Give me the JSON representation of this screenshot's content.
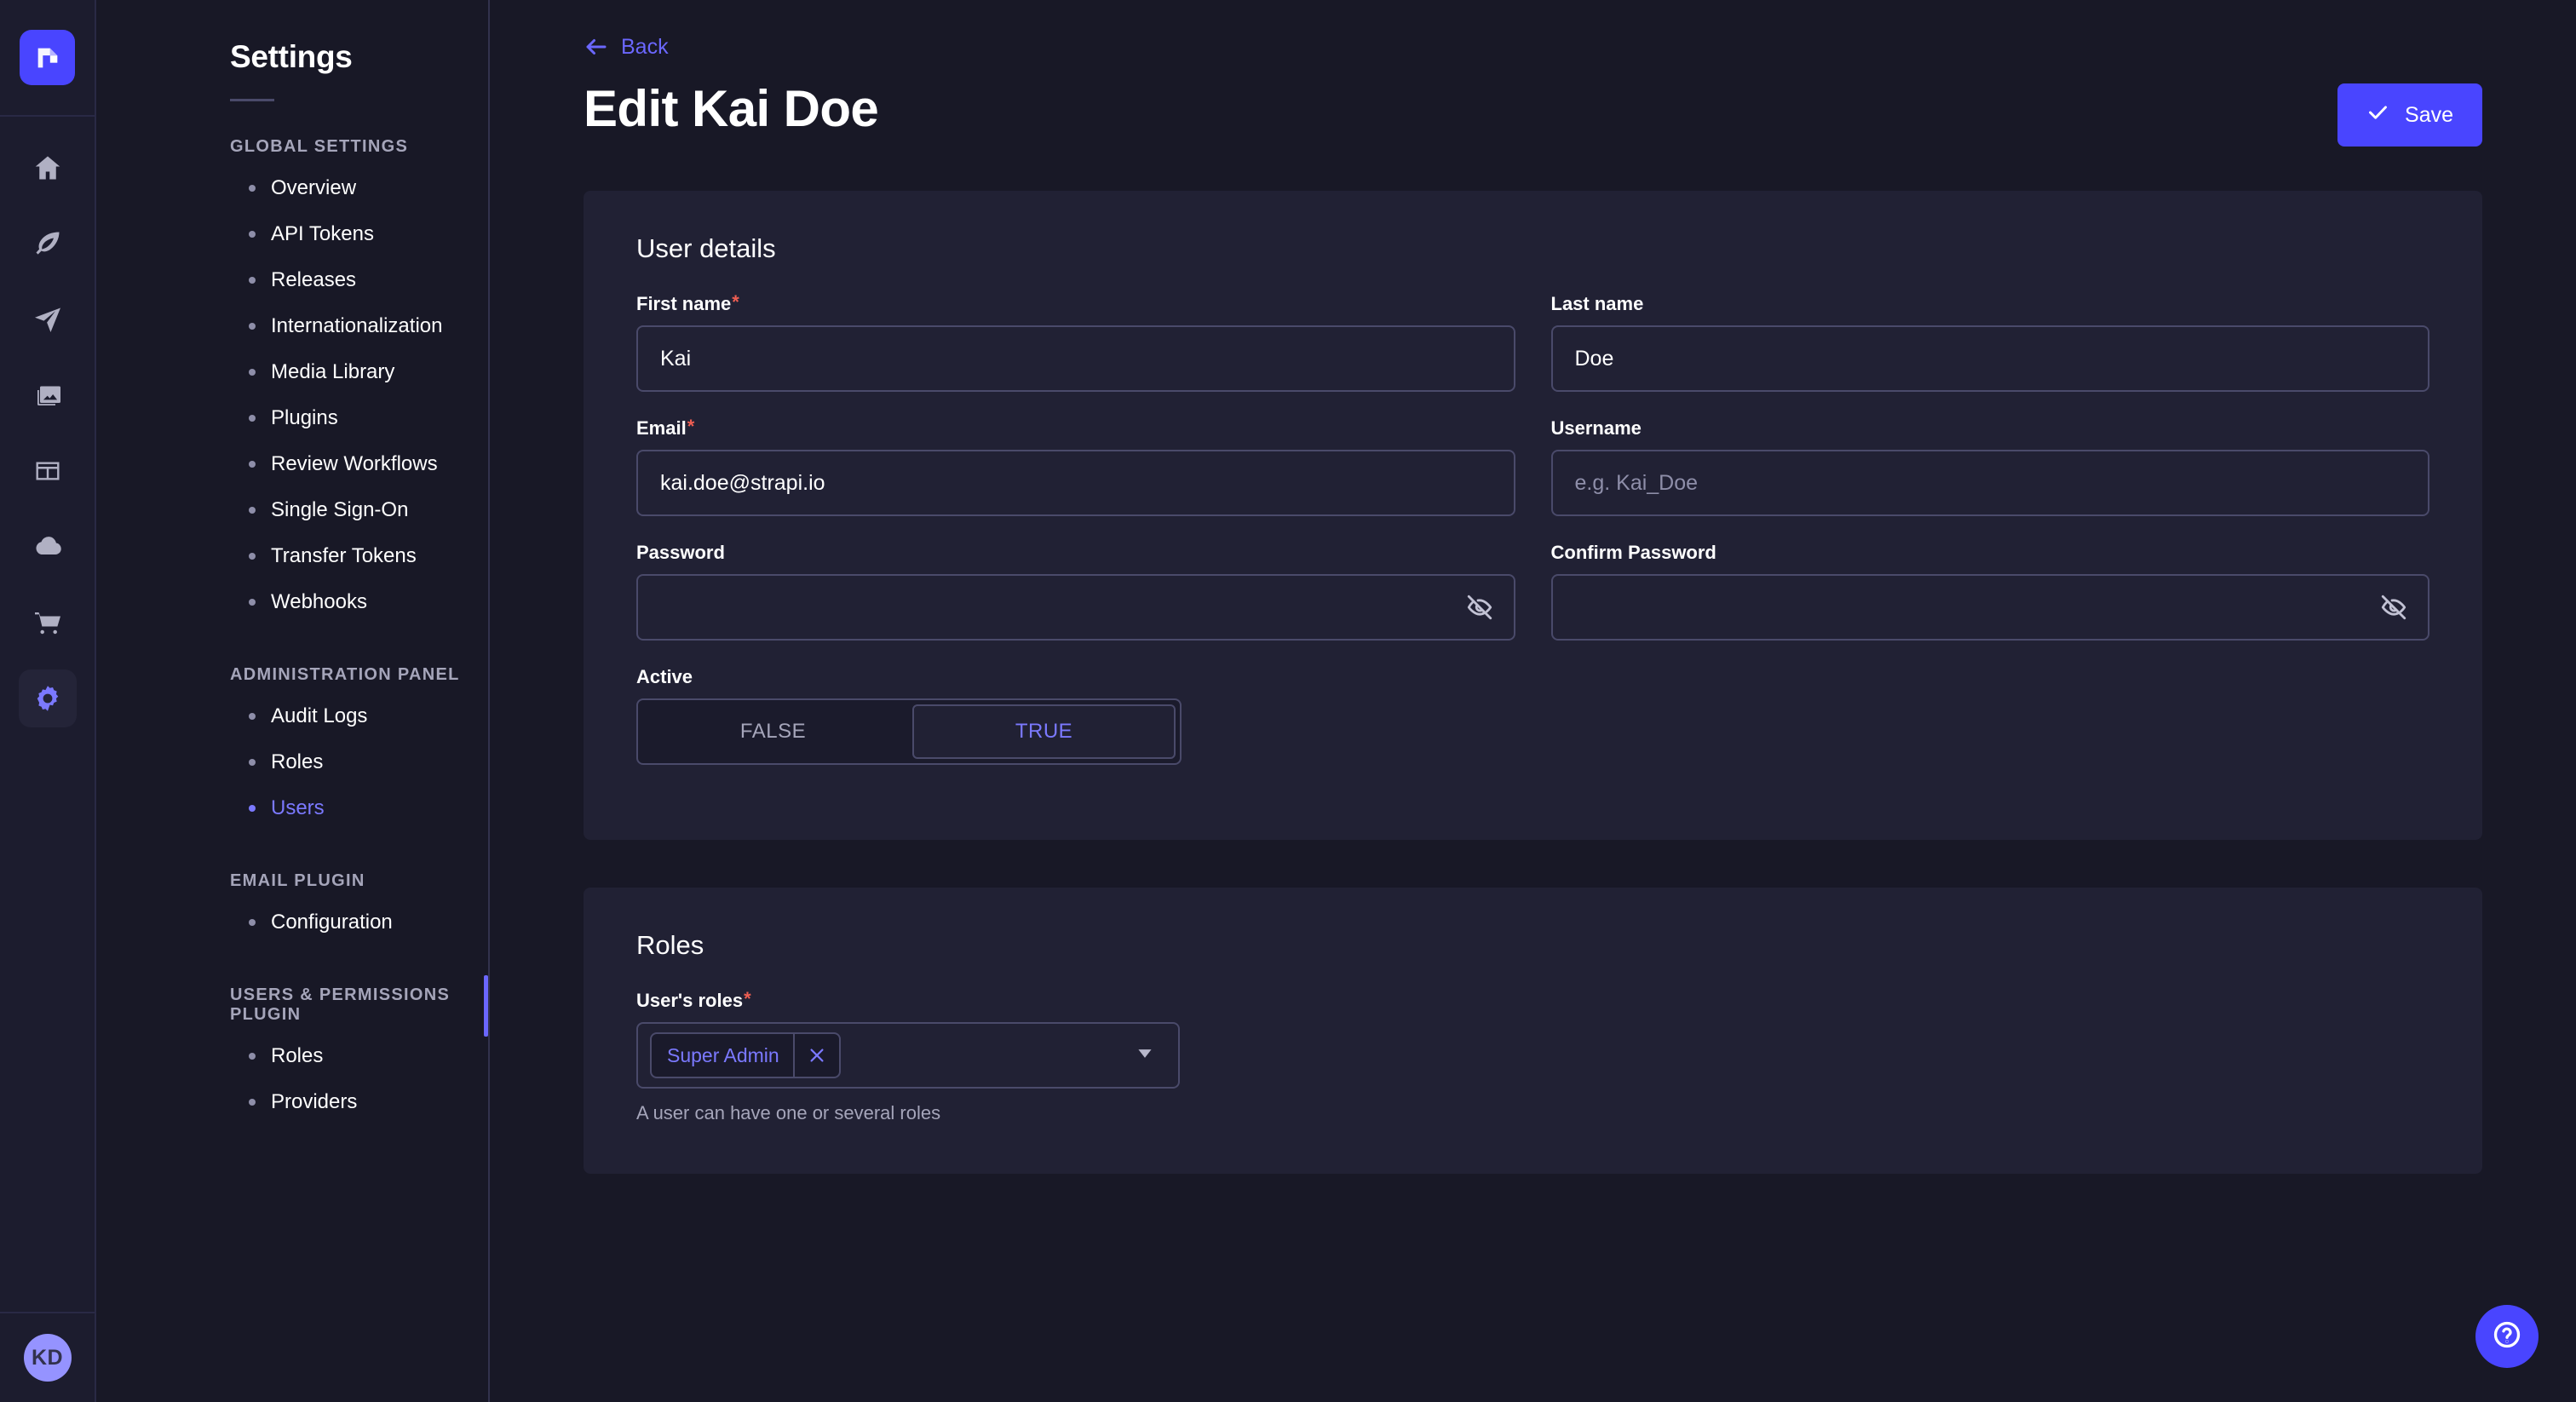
{
  "brand": {
    "accent": "#4945ff",
    "accent_light": "#7b79ff",
    "required_color": "#ee5e52",
    "panel_bg": "#212134",
    "page_bg": "#181826"
  },
  "rail": {
    "logo_icon": "strapi-logo-icon",
    "items": [
      {
        "icon": "home-icon",
        "name": "home",
        "active": false
      },
      {
        "icon": "feather-icon",
        "name": "content-manager",
        "active": false
      },
      {
        "icon": "paper-plane-icon",
        "name": "content-type-builder",
        "active": false
      },
      {
        "icon": "images-icon",
        "name": "media-library",
        "active": false
      },
      {
        "icon": "layout-icon",
        "name": "pages",
        "active": false
      },
      {
        "icon": "cloud-icon",
        "name": "cloud",
        "active": false
      },
      {
        "icon": "shopping-cart-icon",
        "name": "marketplace",
        "active": false
      },
      {
        "icon": "gear-icon",
        "name": "settings",
        "active": true
      }
    ],
    "avatar_initials": "KD"
  },
  "sidebar": {
    "title": "Settings",
    "sections": [
      {
        "label": "GLOBAL SETTINGS",
        "items": [
          {
            "label": "Overview",
            "active": false
          },
          {
            "label": "API Tokens",
            "active": false
          },
          {
            "label": "Releases",
            "active": false
          },
          {
            "label": "Internationalization",
            "active": false
          },
          {
            "label": "Media Library",
            "active": false
          },
          {
            "label": "Plugins",
            "active": false
          },
          {
            "label": "Review Workflows",
            "active": false
          },
          {
            "label": "Single Sign-On",
            "active": false
          },
          {
            "label": "Transfer Tokens",
            "active": false
          },
          {
            "label": "Webhooks",
            "active": false
          }
        ]
      },
      {
        "label": "ADMINISTRATION PANEL",
        "items": [
          {
            "label": "Audit Logs",
            "active": false
          },
          {
            "label": "Roles",
            "active": false
          },
          {
            "label": "Users",
            "active": true
          }
        ]
      },
      {
        "label": "EMAIL PLUGIN",
        "items": [
          {
            "label": "Configuration",
            "active": false
          }
        ]
      },
      {
        "label": "USERS & PERMISSIONS PLUGIN",
        "items": [
          {
            "label": "Roles",
            "active": false
          },
          {
            "label": "Providers",
            "active": false
          }
        ]
      }
    ]
  },
  "header": {
    "back_label": "Back",
    "back_icon": "arrow-left-icon",
    "page_title": "Edit Kai Doe",
    "save_label": "Save",
    "save_icon": "check-icon"
  },
  "user_details": {
    "card_title": "User details",
    "first_name": {
      "label": "First name",
      "required": true,
      "value": "Kai",
      "placeholder": ""
    },
    "last_name": {
      "label": "Last name",
      "required": false,
      "value": "Doe",
      "placeholder": ""
    },
    "email": {
      "label": "Email",
      "required": true,
      "value": "kai.doe@strapi.io",
      "placeholder": ""
    },
    "username": {
      "label": "Username",
      "required": false,
      "value": "",
      "placeholder": "e.g. Kai_Doe"
    },
    "password": {
      "label": "Password",
      "required": false,
      "value": "",
      "placeholder": "",
      "toggle_icon": "eye-off-icon"
    },
    "confirm_password": {
      "label": "Confirm Password",
      "required": false,
      "value": "",
      "placeholder": "",
      "toggle_icon": "eye-off-icon"
    },
    "active": {
      "label": "Active",
      "false_label": "FALSE",
      "true_label": "TRUE",
      "selected": "TRUE"
    }
  },
  "roles": {
    "card_title": "Roles",
    "field_label": "User's roles",
    "required": true,
    "selected_tags": [
      {
        "label": "Super Admin",
        "remove_icon": "close-icon"
      }
    ],
    "dropdown_icon": "chevron-down-icon",
    "hint": "A user can have one or several roles"
  },
  "help": {
    "icon": "question-circle-icon",
    "name": "help-button"
  }
}
